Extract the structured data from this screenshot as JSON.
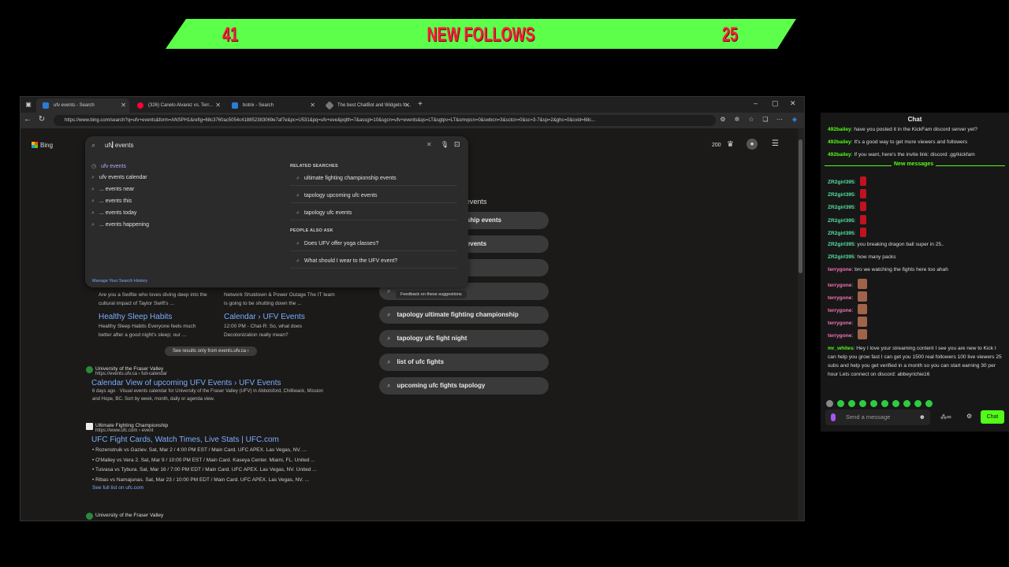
{
  "banner": {
    "left_count": "41",
    "title": "NEW FOLLOWS",
    "right_count": "25",
    "bg_color": "#5cff4a",
    "text_color": "#ff1a3c"
  },
  "browser": {
    "tabs": [
      {
        "label": "ufv events - Search",
        "icon": "bing-icon"
      },
      {
        "label": "(326) Canelo Alvarez vs. Terr...",
        "icon": "youtube-icon"
      },
      {
        "label": "botrix - Search",
        "icon": "bing-icon"
      },
      {
        "label": "The best ChatBot and Widgets fo...",
        "icon": "botrix-icon"
      }
    ],
    "url": "https://www.bing.com/search?q=ufv+events&form=ANSPH1&refig=68c3760ac5054c418852383069e7af7e&pc=U531&pq=ufv+eve&pqlth=7&assgl=10&sgcn=ufv+events&qs=LT&sgtpv=LT&smvpcn=0&swbcn=3&sctcn=0&sc=3-7&sp=2&ghc=0&cvid=68c..."
  },
  "bing": {
    "logo_text": "Bing",
    "search_value": "ufv events",
    "reward_points": "200",
    "suggestions": [
      "ufv events",
      "ufv events calendar",
      "... events near",
      "... events this",
      "... events today",
      "... events happening"
    ],
    "related_heading": "RELATED SEARCHES",
    "related": [
      "ultimate fighting championship events",
      "tapology upcoming ufc events",
      "tapology ufc events"
    ],
    "people_heading": "PEOPLE ALSO ASK",
    "people": [
      "Does UFV offer yoga classes?",
      "What should I wear to the UFV event?"
    ],
    "manage_history": "Manage Your Search History",
    "feedback": "Feedback on these suggestions"
  },
  "related_panel": {
    "heading_fragment": "events",
    "pills": [
      "...pionship events",
      "...c events",
      "",
      "",
      "tapology ultimate fighting championship",
      "tapology ufc fight night",
      "list of ufc fights",
      "upcoming ufc fights tapology"
    ]
  },
  "cards": [
    {
      "snippet": "Are you a Swiftie who loves diving deep into the cultural impact of Taylor Swift's ...",
      "title": "Healthy Sleep Habits",
      "desc": "Healthy Sleep Habits Everyone feels much better after a good night's sleep; our ..."
    },
    {
      "snippet": "Network Shutdown & Power Outage The IT team is going to be shutting down the ...",
      "title": "Calendar › UFV Events",
      "desc": "12:00 PM - Chat-R: So, what does Decolonization really mean?"
    }
  ],
  "see_more": "See results only from events.ufv.ca",
  "results": [
    {
      "site": "University of the Fraser Valley",
      "cite": "https://events.ufv.ca › full-calendar",
      "title": "Calendar View of upcoming UFV Events › UFV Events",
      "desc": "6 days ago · Visual events calendar for University of the Fraser Valley (UFV) in Abbotsford, Chilliwack, Mission and Hope, BC. Sort by week, month, daily or agenda view."
    },
    {
      "site": "Ultimate Fighting Championship",
      "cite": "https://www.ufc.com › event",
      "title": "UFC Fight Cards, Watch Times, Live Stats | UFC.com",
      "bullets": [
        "Rozenstruik vs Gaziev. Sat, Mar 2 / 4:00 PM EST / Main Card. UFC APEX. Las Vegas, NV. ...",
        "O'Malley vs Vera 2. Sat, Mar 9 / 10:00 PM EST / Main Card. Kaseya Center. Miami, FL. United ...",
        "Tuivasa vs Tybura. Sat, Mar 16 / 7:00 PM EDT / Main Card. UFC APEX. Las Vegas, NV. United ...",
        "Ribas vs Namajunas. Sat, Mar 23 / 10:00 PM EDT / Main Card. UFC APEX. Las Vegas, NV. ..."
      ],
      "more": "See full list on ufc.com"
    },
    {
      "site": "University of the Fraser Valley"
    }
  ],
  "chat": {
    "title": "Chat",
    "top_messages": [
      {
        "user": "492bailey",
        "text": "have you posted it in the KickFam discord server yet?"
      },
      {
        "user": "492bailey",
        "text": "It's a good way to get more viewers and followers"
      },
      {
        "user": "492bailey",
        "text": "If you want, here's the invite link: discord .gg/kickfam"
      }
    ],
    "new_messages_label": "New messages",
    "messages": [
      {
        "user": "ZR2girl395",
        "text": "",
        "emote": true
      },
      {
        "user": "ZR2girl395",
        "text": "",
        "emote": true
      },
      {
        "user": "ZR2girl395",
        "text": "",
        "emote": true
      },
      {
        "user": "ZR2girl395",
        "text": "",
        "emote": true
      },
      {
        "user": "ZR2girl395",
        "text": "",
        "emote": true
      },
      {
        "user": "ZR2girl395",
        "text": "you breaking dragon ball super in 25.."
      },
      {
        "user": "ZR2girl395",
        "text": "how many packs"
      },
      {
        "user": "terrygone",
        "text": "bro we watching the fights here too ahah"
      },
      {
        "user": "terrygone",
        "text": "",
        "emote": true
      },
      {
        "user": "terrygone",
        "text": "",
        "emote": true
      },
      {
        "user": "terrygone",
        "text": "",
        "emote": true
      },
      {
        "user": "terrygone",
        "text": "",
        "emote": true
      },
      {
        "user": "terrygone",
        "text": "",
        "emote": true
      }
    ],
    "long_message": {
      "user": "mr_whites",
      "text": "Hey I love your streaming content I see you are new to Kick I can help you grow fast I can get you 1500 real followers 100 live viewers 25 subs and help you get verified in a month so you can start earning 30 per hour Lets connect on discord: abbeyrichie16"
    },
    "input_placeholder": "Send a message",
    "send_label": "Chat"
  }
}
